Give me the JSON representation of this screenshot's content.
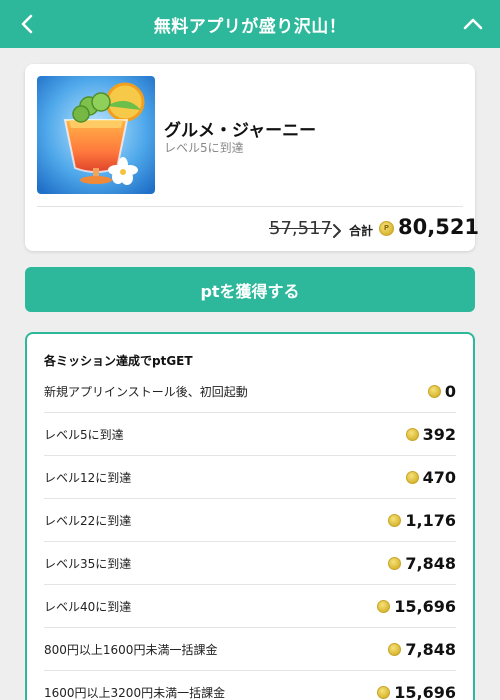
{
  "header": {
    "title": "無料アプリが盛り沢山！",
    "back_icon": "chevron-left-icon",
    "collapse_icon": "chevron-up-icon"
  },
  "app": {
    "name": "グルメ・ジャーニー",
    "subtitle": "レベル5に到達",
    "old_points": "57,517",
    "total_label": "合計",
    "total_points": "80,521",
    "icon": "tropical-drink-app-icon"
  },
  "cta": {
    "label": "ptを獲得する"
  },
  "missions": {
    "title": "各ミッション達成でptGET",
    "items": [
      {
        "label": "新規アプリインストール後、初回起動",
        "points": "0"
      },
      {
        "label": "レベル5に到達",
        "points": "392"
      },
      {
        "label": "レベル12に到達",
        "points": "470"
      },
      {
        "label": "レベル22に到達",
        "points": "1,176"
      },
      {
        "label": "レベル35に到達",
        "points": "7,848"
      },
      {
        "label": "レベル40に到達",
        "points": "15,696"
      },
      {
        "label": "800円以上1600円未満一括課金",
        "points": "7,848"
      },
      {
        "label": "1600円以上3200円未満一括課金",
        "points": "15,696"
      }
    ]
  },
  "colors": {
    "accent": "#2db89b",
    "coin": "#e2c34a",
    "background": "#eeeeee"
  }
}
